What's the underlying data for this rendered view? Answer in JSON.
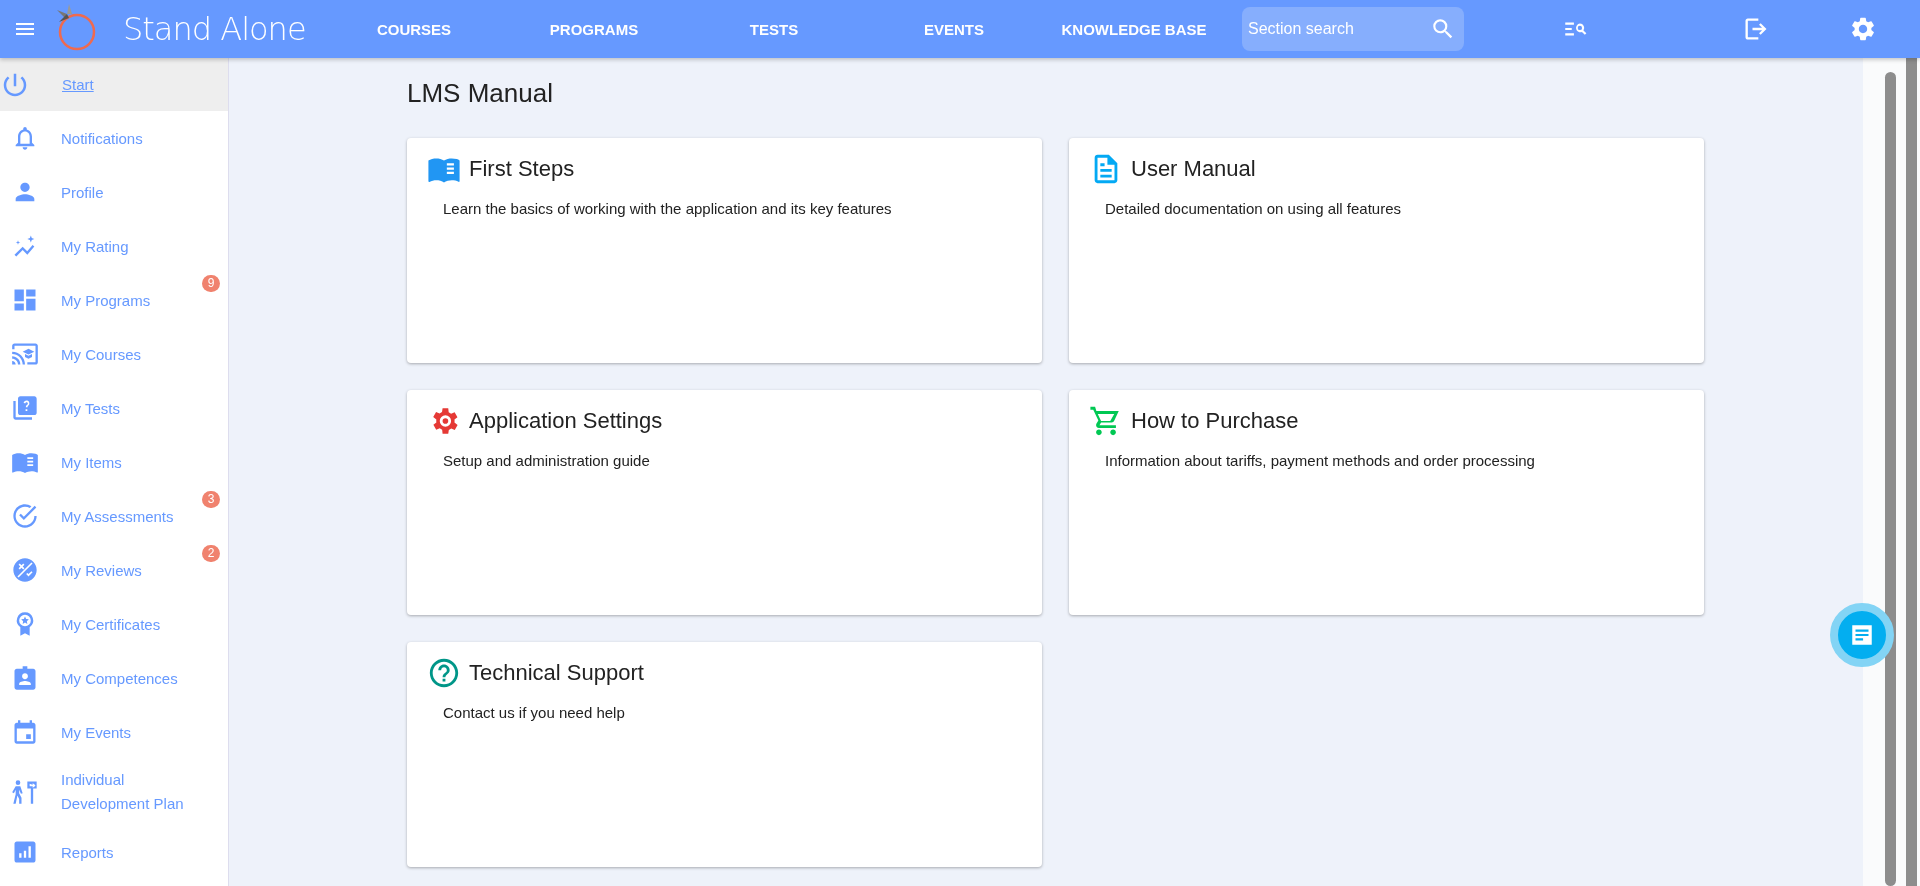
{
  "header": {
    "title": "Stand Alone",
    "nav": [
      {
        "label": "COURSES"
      },
      {
        "label": "PROGRAMS"
      },
      {
        "label": "TESTS"
      },
      {
        "label": "EVENTS"
      },
      {
        "label": "KNOWLEDGE BASE"
      }
    ],
    "search": {
      "placeholder": "Section search"
    }
  },
  "sidebar": {
    "items": [
      {
        "label": "Start",
        "selected": true
      },
      {
        "label": "Notifications",
        "selected": false
      },
      {
        "label": "Profile",
        "selected": false
      },
      {
        "label": "My Rating",
        "selected": false
      },
      {
        "label": "My Programs",
        "selected": false,
        "badge": "9"
      },
      {
        "label": "My Courses",
        "selected": false
      },
      {
        "label": "My Tests",
        "selected": false
      },
      {
        "label": "My Items",
        "selected": false
      },
      {
        "label": "My Assessments",
        "selected": false,
        "badge": "3"
      },
      {
        "label": "My Reviews",
        "selected": false,
        "badge": "2"
      },
      {
        "label": "My Certificates",
        "selected": false
      },
      {
        "label": "My Competences",
        "selected": false
      },
      {
        "label": "My Events",
        "selected": false
      },
      {
        "label": "Individual Development Plan",
        "selected": false
      },
      {
        "label": "Reports",
        "selected": false
      }
    ]
  },
  "page": {
    "title": "LMS Manual",
    "cards": [
      {
        "title": "First Steps",
        "description": "Learn the basics of working with the application and its key features",
        "color": "#2196f3"
      },
      {
        "title": "User Manual",
        "description": "Detailed documentation on using all features",
        "color": "#03a9f4"
      },
      {
        "title": "Application Settings",
        "description": "Setup and administration guide",
        "color": "#e53935"
      },
      {
        "title": "How to Purchase",
        "description": "Information about tariffs, payment methods and order processing",
        "color": "#00c853"
      },
      {
        "title": "Technical Support",
        "description": "Contact us if you need help",
        "color": "#009688"
      }
    ]
  }
}
